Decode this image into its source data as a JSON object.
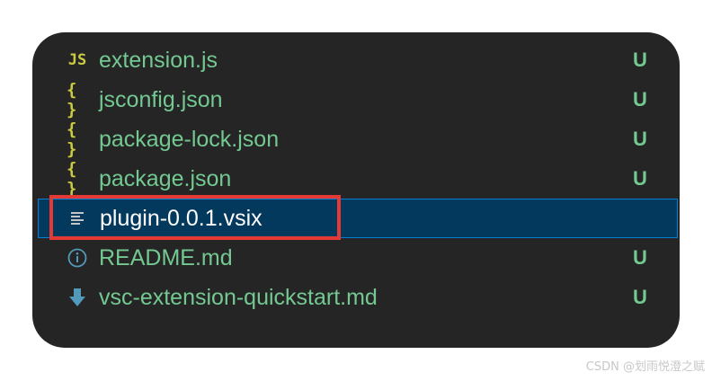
{
  "explorer": {
    "cutoff_above": "",
    "files": [
      {
        "icon": "js-file-icon",
        "icon_text": "JS",
        "name": "extension.js",
        "status": "U"
      },
      {
        "icon": "json-file-icon",
        "icon_text": "{ }",
        "name": "jsconfig.json",
        "status": "U"
      },
      {
        "icon": "json-file-icon",
        "icon_text": "{ }",
        "name": "package-lock.json",
        "status": "U"
      },
      {
        "icon": "json-file-icon",
        "icon_text": "{ }",
        "name": "package.json",
        "status": "U"
      },
      {
        "icon": "text-file-icon",
        "icon_text": "",
        "name": "plugin-0.0.1.vsix",
        "status": "",
        "selected": true
      },
      {
        "icon": "info-icon",
        "icon_text": "",
        "name": "README.md",
        "status": "U"
      },
      {
        "icon": "markdown-download-icon",
        "icon_text": "",
        "name": "vsc-extension-quickstart.md",
        "status": "U"
      }
    ]
  },
  "colors": {
    "panel_bg": "#252526",
    "untracked_green": "#73c991",
    "selection_bg": "#04395e",
    "selection_border": "#007fd4",
    "annotation_red": "#e53935",
    "json_yellow": "#cbcb41",
    "icon_blue": "#519aba"
  },
  "watermark": "CSDN @划雨悦澄之赋"
}
